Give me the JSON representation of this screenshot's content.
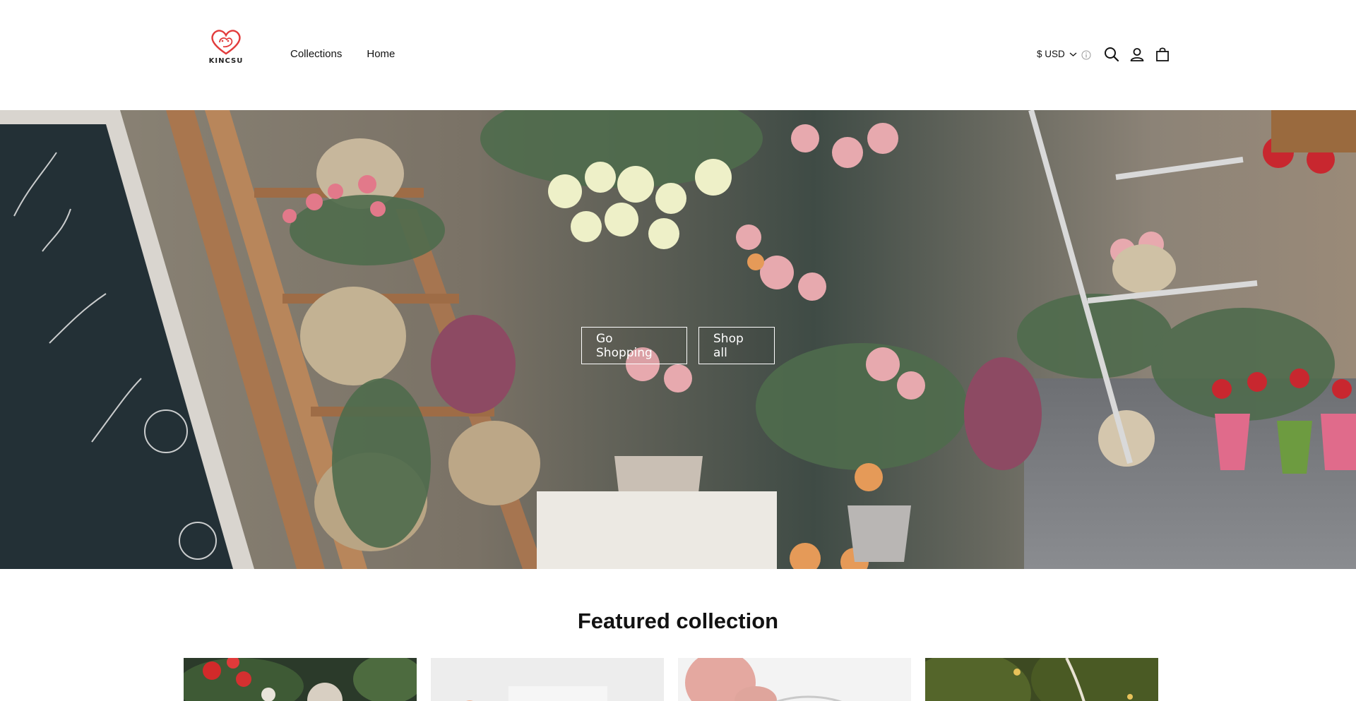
{
  "brand": {
    "name": "KINCSU",
    "logo_icon": "heart-logo-icon",
    "accent": "#e23b3b"
  },
  "nav": {
    "items": [
      {
        "label": "Collections"
      },
      {
        "label": "Home"
      }
    ]
  },
  "header": {
    "currency": {
      "label": "$ USD",
      "icon": "chevron-down-icon"
    },
    "info_icon": "info-icon",
    "search_icon": "search-icon",
    "account_icon": "user-icon",
    "cart_icon": "shopping-bag-icon"
  },
  "hero": {
    "buttons": [
      {
        "label": "Go Shopping"
      },
      {
        "label": "Shop all"
      }
    ]
  },
  "featured": {
    "title": "Featured collection",
    "products": [
      {
        "image": "christmas-ornaments-photo"
      },
      {
        "image": "white-product-photo"
      },
      {
        "image": "hand-holding-photo"
      },
      {
        "image": "christmas-tree-photo"
      }
    ]
  }
}
